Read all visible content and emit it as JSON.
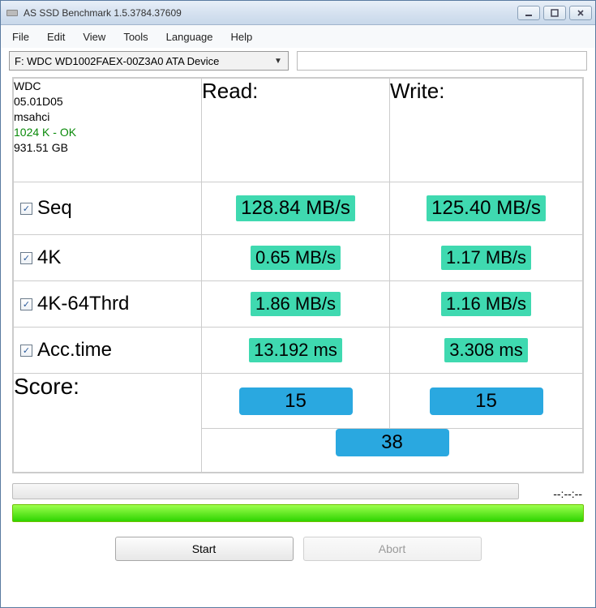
{
  "window": {
    "title": "AS SSD Benchmark 1.5.3784.37609"
  },
  "menu": {
    "file": "File",
    "edit": "Edit",
    "view": "View",
    "tools": "Tools",
    "language": "Language",
    "help": "Help"
  },
  "drive": {
    "selected": "F: WDC WD1002FAEX-00Z3A0 ATA Device"
  },
  "info": {
    "vendor": "WDC",
    "firmware": "05.01D05",
    "driver": "msahci",
    "align": "1024 K - OK",
    "capacity": "931.51 GB"
  },
  "headers": {
    "read": "Read:",
    "write": "Write:",
    "score": "Score:"
  },
  "rows": {
    "seq": {
      "label": "Seq",
      "read": "128.84 MB/s",
      "write": "125.40 MB/s"
    },
    "fourk": {
      "label": "4K",
      "read": "0.65 MB/s",
      "write": "1.17 MB/s"
    },
    "thrd": {
      "label": "4K-64Thrd",
      "read": "1.86 MB/s",
      "write": "1.16 MB/s"
    },
    "acc": {
      "label": "Acc.time",
      "read": "13.192 ms",
      "write": "3.308 ms"
    }
  },
  "scores": {
    "read": "15",
    "write": "15",
    "total": "38"
  },
  "timing": "--:--:--",
  "buttons": {
    "start": "Start",
    "abort": "Abort"
  }
}
